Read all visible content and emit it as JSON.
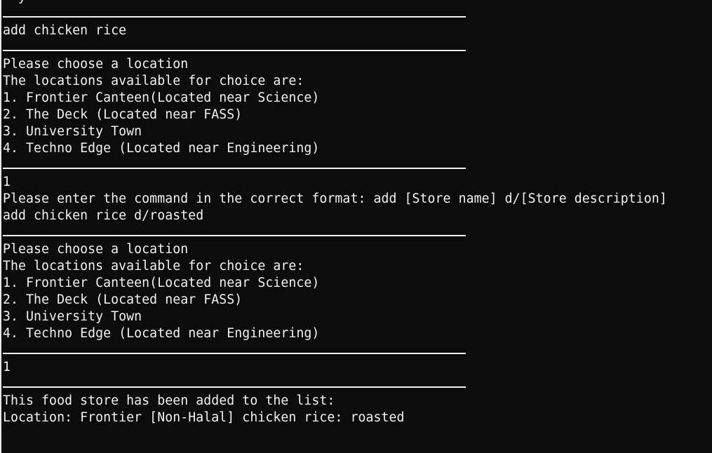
{
  "terminal": {
    "lines": [
      {
        "type": "text",
        "text": "  y"
      },
      {
        "type": "sep"
      },
      {
        "type": "text",
        "text": "add chicken rice"
      },
      {
        "type": "sep"
      },
      {
        "type": "text",
        "text": "Please choose a location"
      },
      {
        "type": "text",
        "text": "The locations available for choice are:"
      },
      {
        "type": "text",
        "text": "1. Frontier Canteen(Located near Science)"
      },
      {
        "type": "text",
        "text": "2. The Deck (Located near FASS)"
      },
      {
        "type": "text",
        "text": "3. University Town"
      },
      {
        "type": "text",
        "text": "4. Techno Edge (Located near Engineering)"
      },
      {
        "type": "sep"
      },
      {
        "type": "text",
        "text": "1"
      },
      {
        "type": "text",
        "text": "Please enter the command in the correct format: add [Store name] d/[Store description]"
      },
      {
        "type": "text",
        "text": "add chicken rice d/roasted"
      },
      {
        "type": "sep"
      },
      {
        "type": "text",
        "text": "Please choose a location"
      },
      {
        "type": "text",
        "text": "The locations available for choice are:"
      },
      {
        "type": "text",
        "text": "1. Frontier Canteen(Located near Science)"
      },
      {
        "type": "text",
        "text": "2. The Deck (Located near FASS)"
      },
      {
        "type": "text",
        "text": "3. University Town"
      },
      {
        "type": "text",
        "text": "4. Techno Edge (Located near Engineering)"
      },
      {
        "type": "sep"
      },
      {
        "type": "text",
        "text": "1"
      },
      {
        "type": "sep"
      },
      {
        "type": "text",
        "text": "This food store has been added to the list:"
      },
      {
        "type": "text",
        "text": "Location: Frontier [Non-Halal] chicken rice: roasted"
      },
      {
        "type": "text",
        "text": ""
      },
      {
        "type": "sep"
      }
    ]
  }
}
